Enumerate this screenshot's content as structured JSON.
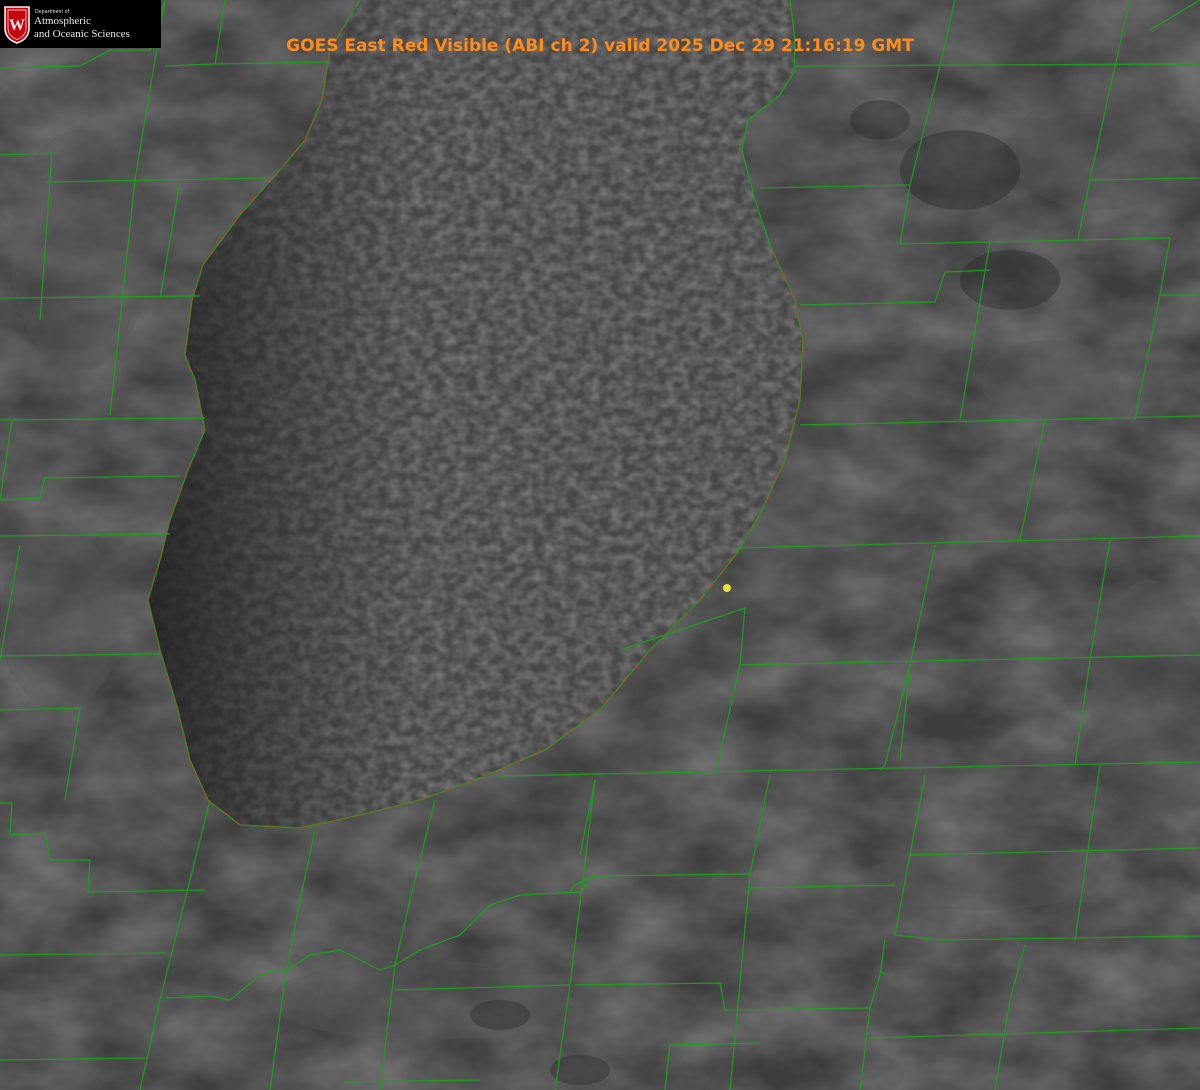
{
  "header": {
    "title": "GOES East Red Visible (ABI ch 2) valid 2025 Dec 29 21:16:19 GMT"
  },
  "logo": {
    "department_label": "Department of",
    "line1": "Atmospheric",
    "line2": "and Oceanic Sciences",
    "shield_letter": "W"
  },
  "colors": {
    "title": "#ff8c1a",
    "boundary_lines": "#1e9e1e",
    "shoreline_red": "#d23a1e",
    "marker": "#e8e03a",
    "lake": "#4a4a4a",
    "land": "#3c3c3c"
  },
  "icons": {
    "logo": "uw-shield-icon",
    "marker": "station-marker-icon"
  }
}
